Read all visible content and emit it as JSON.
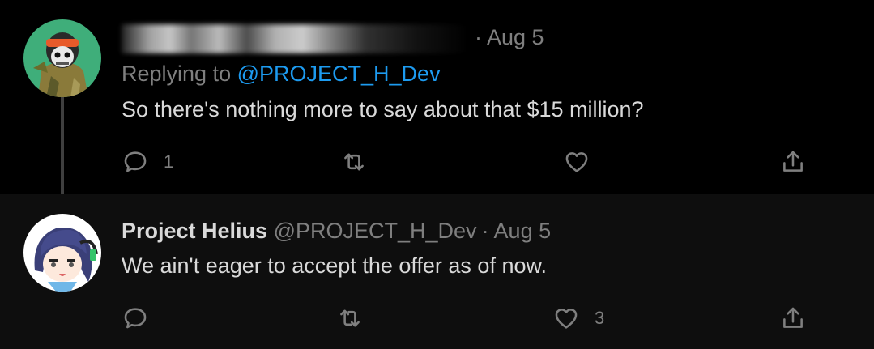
{
  "tweets": [
    {
      "author_name": "",
      "handle": "",
      "date": "Aug 5",
      "replying_prefix": "Replying to",
      "replying_handle": "@PROJECT_H_Dev",
      "text": "So there's nothing more to say about that $15 million?",
      "reply_count": "1",
      "retweet_count": "",
      "like_count": ""
    },
    {
      "author_name": "Project Helius",
      "handle": "@PROJECT_H_Dev",
      "date": "Aug 5",
      "text": "We ain't eager to accept the offer as of now.",
      "reply_count": "",
      "retweet_count": "",
      "like_count": "3"
    }
  ],
  "icons": {
    "reply": "reply-icon",
    "retweet": "retweet-icon",
    "like": "heart-icon",
    "share": "share-icon"
  },
  "colors": {
    "background": "#000000",
    "reply_background": "#0e0e0e",
    "text": "#d9d9d9",
    "muted": "#7f7f7f",
    "link": "#1d9bf0"
  }
}
